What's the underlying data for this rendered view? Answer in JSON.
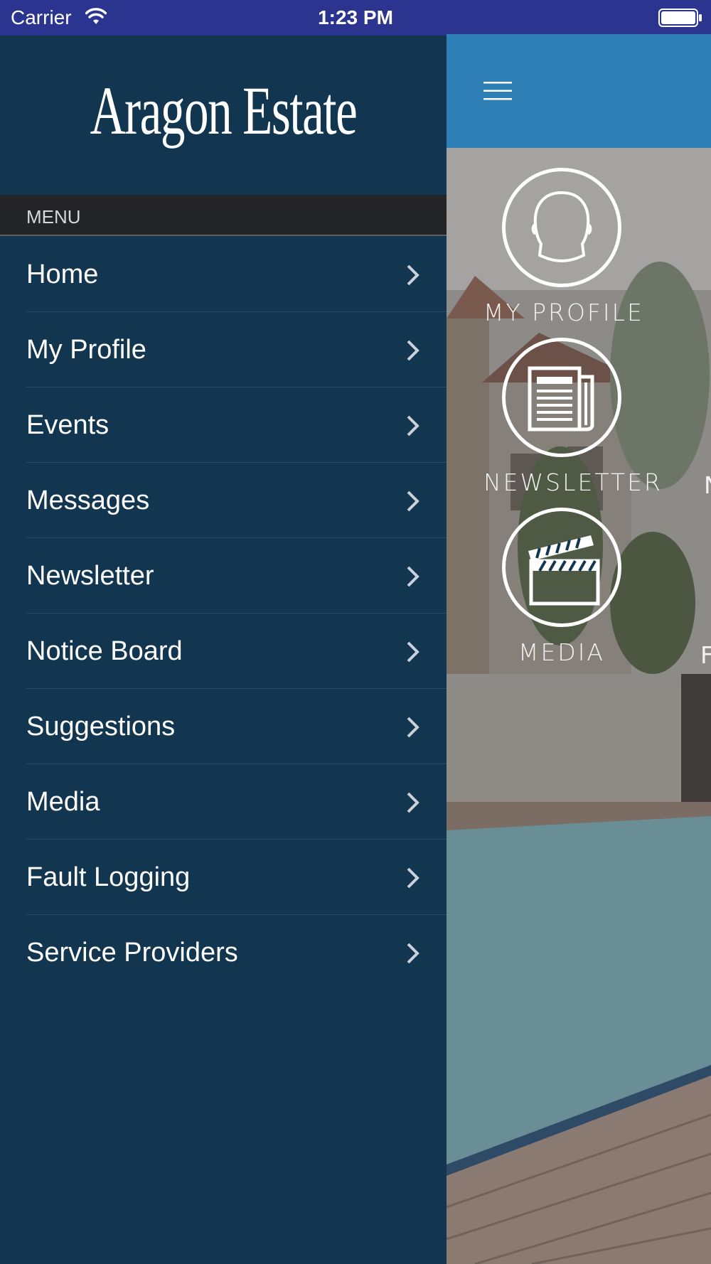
{
  "status_bar": {
    "carrier": "Carrier",
    "time": "1:23 PM"
  },
  "drawer": {
    "logo_text": "Aragon Estate",
    "section_title": "MENU",
    "items": [
      {
        "label": "Home"
      },
      {
        "label": "My Profile"
      },
      {
        "label": "Events"
      },
      {
        "label": "Messages"
      },
      {
        "label": "Newsletter"
      },
      {
        "label": "Notice Board"
      },
      {
        "label": "Suggestions"
      },
      {
        "label": "Media"
      },
      {
        "label": "Fault Logging"
      },
      {
        "label": "Service Providers"
      }
    ]
  },
  "main": {
    "tiles": [
      {
        "label": "MY PROFILE",
        "icon": "person-icon"
      },
      {
        "label": "NEWSLETTER",
        "icon": "newspaper-icon"
      },
      {
        "label": "MEDIA",
        "icon": "clapperboard-icon"
      }
    ],
    "peek_labels": [
      "N",
      "F"
    ]
  },
  "colors": {
    "status_bar": "#2b3590",
    "drawer": "#12364f",
    "section_header": "#222426",
    "app_header": "#2d7fb6"
  }
}
